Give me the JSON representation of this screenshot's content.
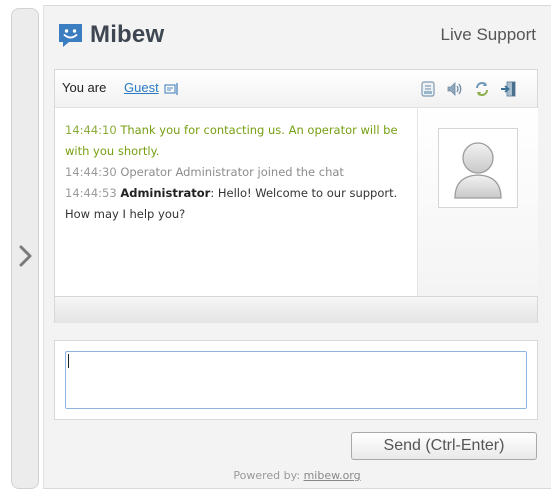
{
  "brand": {
    "name": "Mibew",
    "logo_icon": "speech-bubble-smiley-icon",
    "accent": "#3a7dc0"
  },
  "header": {
    "title": "Live Support"
  },
  "chat": {
    "you_are_label": "You are",
    "guest_name": "Guest",
    "toolbar_icons": [
      "mail-transcript-icon",
      "sound-icon",
      "refresh-icon",
      "exit-icon"
    ],
    "messages": [
      {
        "time": "14:44:10",
        "author": "",
        "text": "Thank you for contacting us. An operator will be with you shortly.",
        "kind": "system"
      },
      {
        "time": "14:44:30",
        "author": "",
        "text": "Operator Administrator joined the chat",
        "kind": "info"
      },
      {
        "time": "14:44:53",
        "author": "Administrator",
        "text": ": Hello! Welcome to our support. How may I help you?",
        "kind": "operator"
      }
    ]
  },
  "input": {
    "value": ""
  },
  "send_button": {
    "label": "Send (Ctrl-Enter)"
  },
  "footer": {
    "powered_by": "Powered by:",
    "link": "mibew.org"
  }
}
